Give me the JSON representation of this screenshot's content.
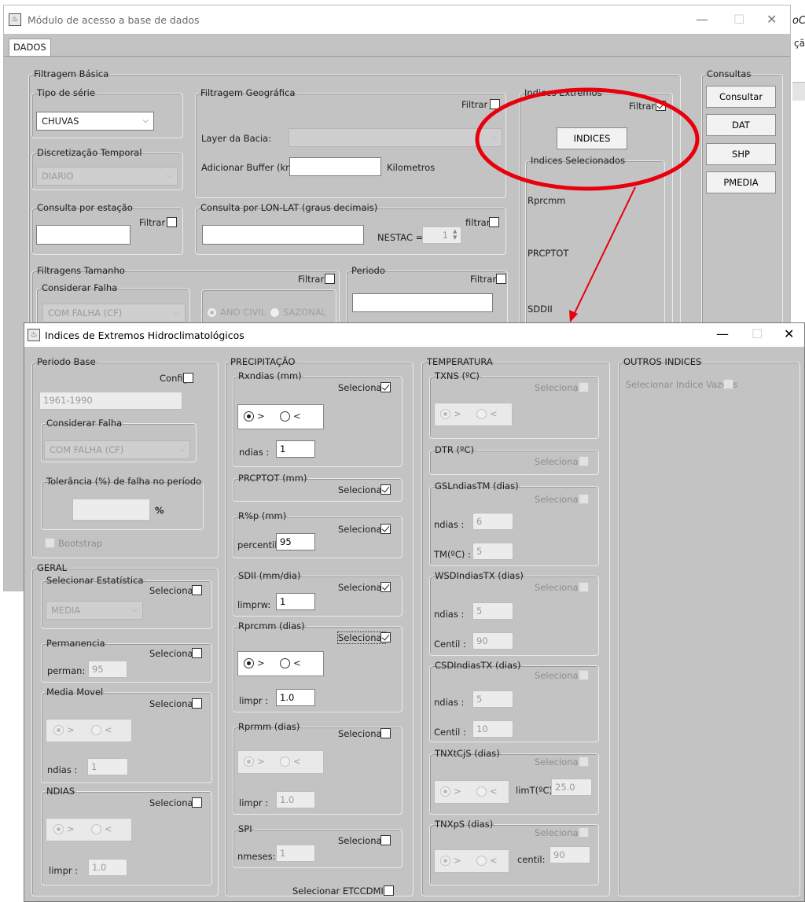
{
  "colors": {
    "ellipse": "#e8000d",
    "arrow": "#e8000d"
  },
  "back": {
    "title": "Módulo de acesso a base de dados",
    "side_text_1": "oCo",
    "side_text_2": "çãc",
    "tab": "DADOS",
    "filtragem_basica": "Filtragem Básica",
    "tipo_serie": {
      "legend": "Tipo de série",
      "value": "CHUVAS"
    },
    "discretizacao": {
      "legend": "Discretização Temporal",
      "value": "DIARIO"
    },
    "geo": {
      "legend": "Filtragem Geográfica",
      "filtrar": "Filtrar",
      "layer_label": "Layer da Bacia:",
      "buffer_label": "Adicionar Buffer (km):",
      "km": "Kilometros"
    },
    "estacao": {
      "legend": "Consulta por estação",
      "filtrar": "Filtrar"
    },
    "lonlat": {
      "legend": "Consulta por LON-LAT (graus decimais)",
      "filtrar": "filtrar",
      "nestac": "NESTAC =",
      "nestac_value": "1"
    },
    "tamanho": {
      "legend": "Filtragens Tamanho",
      "filtrar": "Filtrar",
      "considerar": "Considerar Falha",
      "falha_value": "COM FALHA (CF)",
      "ano_civil": "ANO CIVIL",
      "sazonal": "SAZONAL"
    },
    "periodo": {
      "legend": "Periodo",
      "filtrar": "Filtrar"
    },
    "indices": {
      "legend": "Indices Extremos",
      "filtrar": "Filtrar",
      "button": "INDICES",
      "selecionados": "Indices Selecionados",
      "items": [
        "Rprcmm",
        "PRCPTOT",
        "SDDII"
      ]
    },
    "consultas": {
      "legend": "Consultas",
      "buttons": [
        "Consultar",
        "DAT",
        "SHP",
        "PMEDIA"
      ]
    }
  },
  "front": {
    "title": "Indices de Extremos Hidroclimatológicos",
    "periodo_base": {
      "legend": "Periodo Base",
      "config": "Config",
      "value": "1961-1990",
      "considerar": "Considerar Falha",
      "falha_value": "COM FALHA (CF)",
      "tolerancia": "Tolerância (%) de falha no período",
      "pct": "%",
      "bootstrap": "Bootstrap"
    },
    "geral": {
      "legend": "GERAL",
      "estat": {
        "legend": "Selecionar Estatística",
        "sel": "Selecionar",
        "value": "MEDIA"
      },
      "perm": {
        "legend": "Permanencia",
        "sel": "Selecionar",
        "label": "perman:",
        "value": "95"
      },
      "movel": {
        "legend": "Media Movel",
        "sel": "Selecionar",
        "label": "ndias :",
        "value": "1"
      },
      "ndias": {
        "legend": "NDIAS",
        "sel": "Selecionar",
        "label": "limpr :",
        "value": "1.0"
      }
    },
    "precip": {
      "legend": "PRECIPITAÇÃO",
      "rxndias": {
        "legend": "Rxndias (mm)",
        "sel": "Selecionar",
        "label": "ndias :",
        "value": "1"
      },
      "prcptot": {
        "legend": "PRCPTOT (mm)",
        "sel": "Selecionar"
      },
      "rp": {
        "legend": "R%p (mm)",
        "sel": "Selecionar",
        "label": "percentil:",
        "value": "95"
      },
      "sdii": {
        "legend": "SDII (mm/dia)",
        "sel": "Selecionar",
        "label": "limprw:",
        "value": "1"
      },
      "rprcmm": {
        "legend": "Rprcmm (dias)",
        "sel": "Selecionar",
        "label": "limpr :",
        "value": "1.0"
      },
      "rprmm": {
        "legend": "Rprmm (dias)",
        "sel": "Selecionar",
        "label": "limpr :",
        "value": "1.0"
      },
      "spi": {
        "legend": "SPI",
        "sel": "Selecionar",
        "label": "nmeses:",
        "value": "1"
      },
      "etccdmi": "Selecionar ETCCDMI"
    },
    "temp": {
      "legend": "TEMPERATURA",
      "txns": {
        "legend": "TXNS (ºC)",
        "sel": "Selecionar"
      },
      "dtr": {
        "legend": "DTR (ºC)",
        "sel": "Selecionar"
      },
      "gsl": {
        "legend": "GSLndiasTM (dias)",
        "sel": "Selecionar",
        "l1": "ndias :",
        "v1": "6",
        "l2": "TM(ºC) :",
        "v2": "5"
      },
      "wsd": {
        "legend": "WSDIndiasTX (dias)",
        "sel": "Selecionar",
        "l1": "ndias :",
        "v1": "5",
        "l2": "Centil :",
        "v2": "90"
      },
      "csd": {
        "legend": "CSDIndiasTX (dias)",
        "sel": "Selecionar",
        "l1": "ndias :",
        "v1": "5",
        "l2": "Centil :",
        "v2": "10"
      },
      "tnx": {
        "legend": "TNXtCjS (dias)",
        "sel": "Selecionar",
        "label": "limT(ºC):",
        "value": "25.0"
      },
      "tnxp": {
        "legend": "TNXpS (dias)",
        "sel": "Selecionar",
        "label": "centil:",
        "value": "90"
      }
    },
    "outros": {
      "legend": "OUTROS INDICES",
      "sel": "Selecionar Indice Vazoes"
    },
    "radio_gt": ">",
    "radio_lt": "<"
  }
}
